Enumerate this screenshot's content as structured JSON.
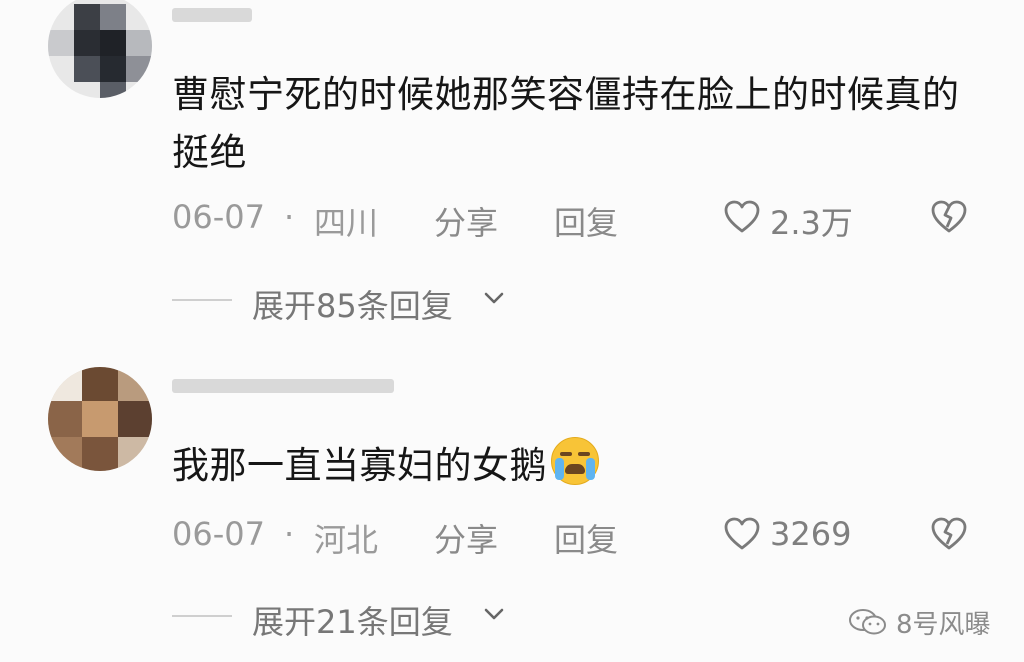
{
  "comments": [
    {
      "text": "曹慰宁死的时候她那笑容僵持在脸上的时候真的挺绝",
      "date": "06-07",
      "separator": "·",
      "location": "四川",
      "share_label": "分享",
      "reply_label": "回复",
      "likes": "2.3万",
      "expand_label": "展开85条回复"
    },
    {
      "text": "我那一直当寡妇的女鹅",
      "emoji": "loudly-crying-face-icon",
      "date": "06-07",
      "separator": "·",
      "location": "河北",
      "share_label": "分享",
      "reply_label": "回复",
      "likes": "3269",
      "expand_label": "展开21条回复"
    }
  ],
  "watermark": {
    "text": "8号风曝",
    "icon": "wechat-icon"
  },
  "colors": {
    "background": "#fbfbfb",
    "text": "#161616",
    "meta": "#9a9a9a"
  }
}
